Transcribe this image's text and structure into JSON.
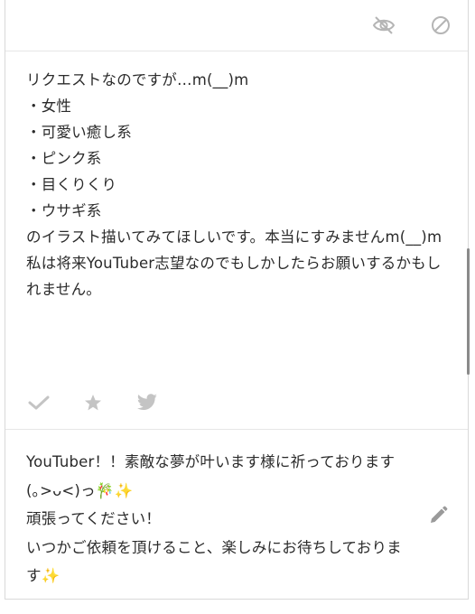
{
  "question": {
    "text": "リクエストなのですが…m(__)m\n・女性\n・可愛い癒し系\n・ピンク系\n・目くりくり\n・ウサギ系\nのイラスト描いてみてほしいです。本当にすみませんm(__)m\n私は将来YouTuber志望なのでもしかしたらお願いするかもしれません。"
  },
  "answer": {
    "text": "YouTuber！！素敵な夢が叶います様に祈っております(｡>ᴗ<)っ🎋✨\n頑張ってください！\nいつかご依頼を頂けること、楽しみにお待ちしております✨"
  },
  "icons": {
    "hide": "eye-off-icon",
    "block": "block-icon",
    "check": "check-icon",
    "star": "star-icon",
    "twitter": "twitter-icon",
    "edit": "pencil-icon"
  },
  "colors": {
    "icon": "#b5b5b5",
    "text": "#2b2b2b",
    "border": "#d9d9d9"
  }
}
